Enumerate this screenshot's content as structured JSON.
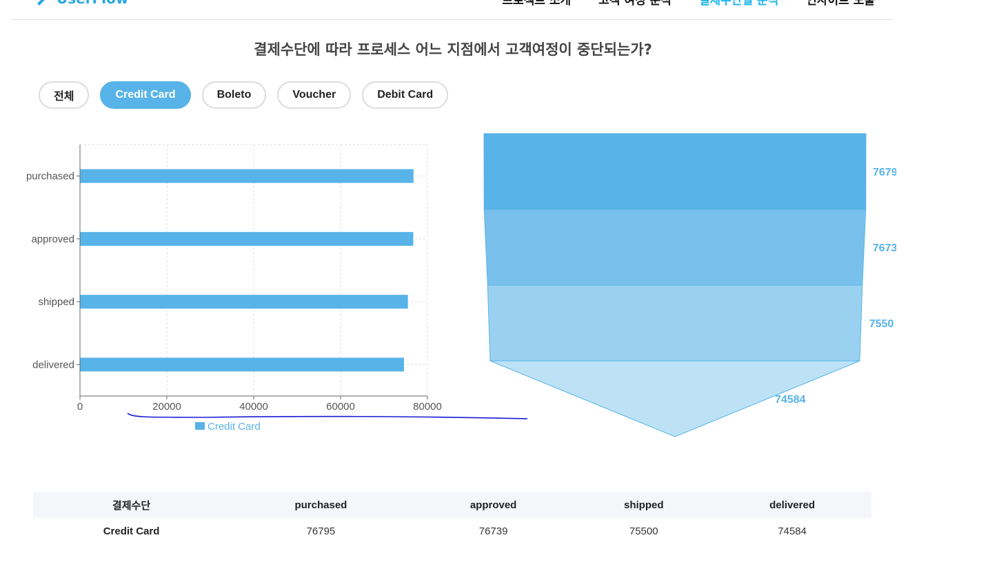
{
  "header": {
    "brand": "UserFlow",
    "nav": [
      {
        "label": "프로젝트 소개",
        "active": false
      },
      {
        "label": "고객 여정 분석",
        "active": false
      },
      {
        "label": "결제수단별 분석",
        "active": true
      },
      {
        "label": "인사이트 도출",
        "active": false
      }
    ],
    "brand_color": "#29a8e0",
    "active_color": "#18b4ee"
  },
  "question": "결제수단에 따라 프로세스 어느 지점에서 고객여정이 중단되는가?",
  "filters": {
    "items": [
      "전체",
      "Credit Card",
      "Boleto",
      "Voucher",
      "Debit Card"
    ],
    "selected": "Credit Card",
    "accent": "#57b3e8"
  },
  "chart_data": [
    {
      "type": "bar",
      "orientation": "horizontal",
      "categories": [
        "purchased",
        "approved",
        "shipped",
        "delivered"
      ],
      "series": [
        {
          "name": "Credit Card",
          "values": [
            76795,
            76739,
            75500,
            74584
          ],
          "color": "#57b3e8"
        }
      ],
      "xlim": [
        0,
        80000
      ],
      "xticks": [
        0,
        20000,
        40000,
        60000,
        80000
      ],
      "grid": true,
      "legend": "bottom-center"
    },
    {
      "type": "funnel",
      "stages": [
        "purchased",
        "approved",
        "shipped",
        "delivered"
      ],
      "values": [
        76795,
        76739,
        75500,
        74584
      ],
      "labels": [
        "7679",
        "7673",
        "7550",
        "74584"
      ],
      "colors": [
        "#57b3e8",
        "#79c1ec",
        "#9bd1f0",
        "#bde2f6"
      ]
    }
  ],
  "table": {
    "columns": [
      "결제수단",
      "purchased",
      "approved",
      "shipped",
      "delivered"
    ],
    "rows": [
      [
        "Credit Card",
        "76795",
        "76739",
        "75500",
        "74584"
      ]
    ]
  }
}
